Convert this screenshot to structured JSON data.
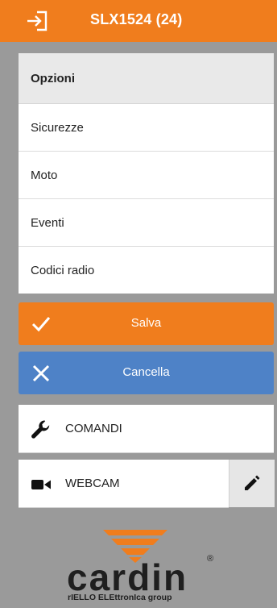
{
  "header": {
    "title": "SLX1524 (24)",
    "accent": "#f07d1d",
    "login_icon": "login-icon"
  },
  "menu": {
    "title": "Opzioni",
    "items": [
      {
        "label": "Sicurezze"
      },
      {
        "label": "Moto"
      },
      {
        "label": "Eventi"
      },
      {
        "label": "Codici radio"
      }
    ]
  },
  "actions": {
    "save": {
      "label": "Salva",
      "icon": "check-icon",
      "color": "#f07d1d"
    },
    "cancel": {
      "label": "Cancella",
      "icon": "close-icon",
      "color": "#4e82c7"
    }
  },
  "controls": {
    "comandi": {
      "label": "COMANDI",
      "icon": "wrench-icon"
    },
    "webcam": {
      "label": "WEBCAM",
      "icon": "video-camera-icon",
      "edit_icon": "pencil-icon"
    }
  },
  "brand": {
    "name": "cardin",
    "tagline": "rIELLO ELEttronIca group",
    "registered": "®"
  }
}
